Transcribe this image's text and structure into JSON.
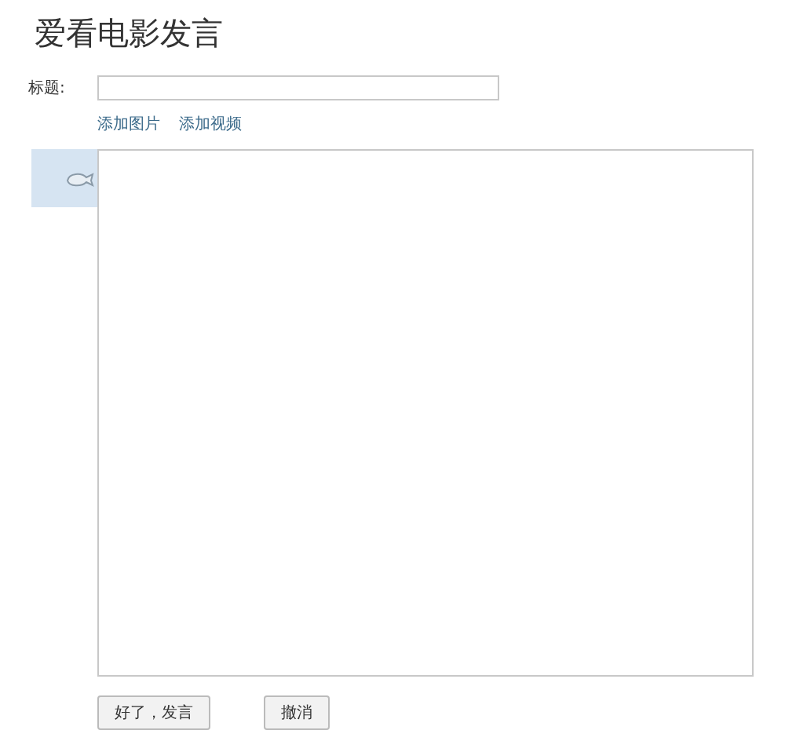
{
  "title": "爱看电影发言",
  "title_field": {
    "label": "标题:"
  },
  "links": [
    "添加图片",
    "添加视频"
  ],
  "buttons": [
    "好了，发言",
    "撤消"
  ]
}
